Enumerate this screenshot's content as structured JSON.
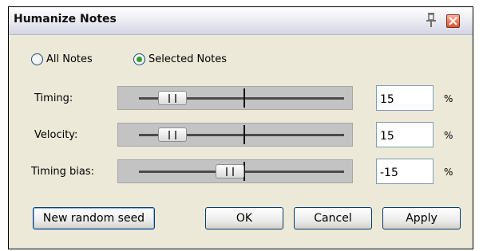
{
  "window": {
    "title": "Humanize Notes"
  },
  "scope": {
    "all_notes_label": "All Notes",
    "selected_notes_label": "Selected Notes",
    "selected": "Selected Notes"
  },
  "params": [
    {
      "label": "Timing:",
      "value": "15",
      "unit": "%",
      "slider_level": 0.15
    },
    {
      "label": "Velocity:",
      "value": "15",
      "unit": "%",
      "slider_level": 0.15
    },
    {
      "label": "Timing bias:",
      "value": "-15",
      "unit": "%",
      "slider_level": -0.15
    }
  ],
  "buttons": {
    "new_seed": "New random seed",
    "ok": "OK",
    "cancel": "Cancel",
    "apply": "Apply"
  },
  "colors": {
    "dialog_bg": "#ece9d8",
    "close_button": "#e04f2a",
    "radio_checked": "#2f9e2f"
  }
}
